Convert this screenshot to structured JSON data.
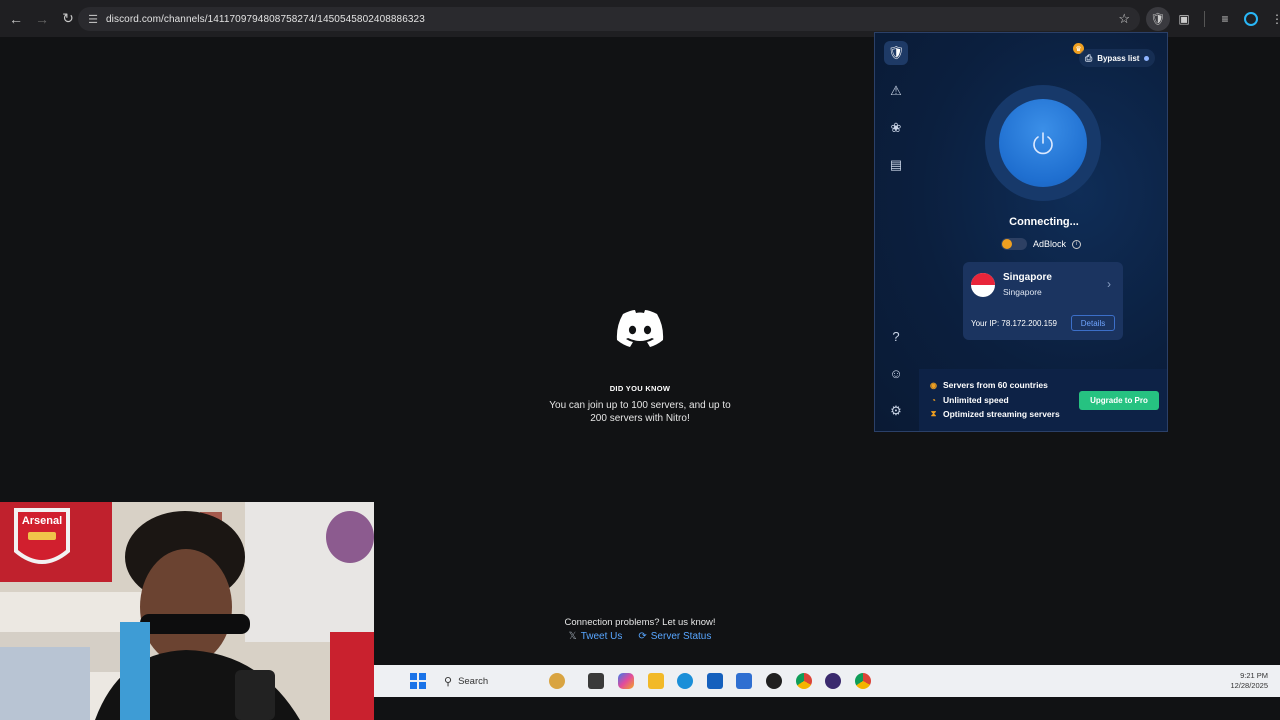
{
  "browser": {
    "url": "discord.com/channels/1411709794808758274/1450545802408886323"
  },
  "discord": {
    "did_you_know": "DID YOU KNOW",
    "tip": "You can join up to 100 servers, and up to 200 servers with Nitro!",
    "connection_problems": "Connection problems? Let us know!",
    "tweet_us": "Tweet Us",
    "server_status": "Server Status"
  },
  "vpn": {
    "bypass_label": "Bypass list",
    "status": "Connecting...",
    "adblock_label": "AdBlock",
    "location": {
      "name": "Singapore",
      "sub": "Singapore"
    },
    "ip_text": "Your IP: 78.172.200.159",
    "details_label": "Details",
    "promo": {
      "line1": "Servers from 60 countries",
      "line2": "Unlimited speed",
      "line3": "Optimized streaming servers",
      "upgrade_label": "Upgrade to Pro"
    },
    "accent": "#1f6fd0"
  },
  "taskbar": {
    "search_label": "Search",
    "time": "9:21 PM",
    "date": "12/28/2025"
  }
}
